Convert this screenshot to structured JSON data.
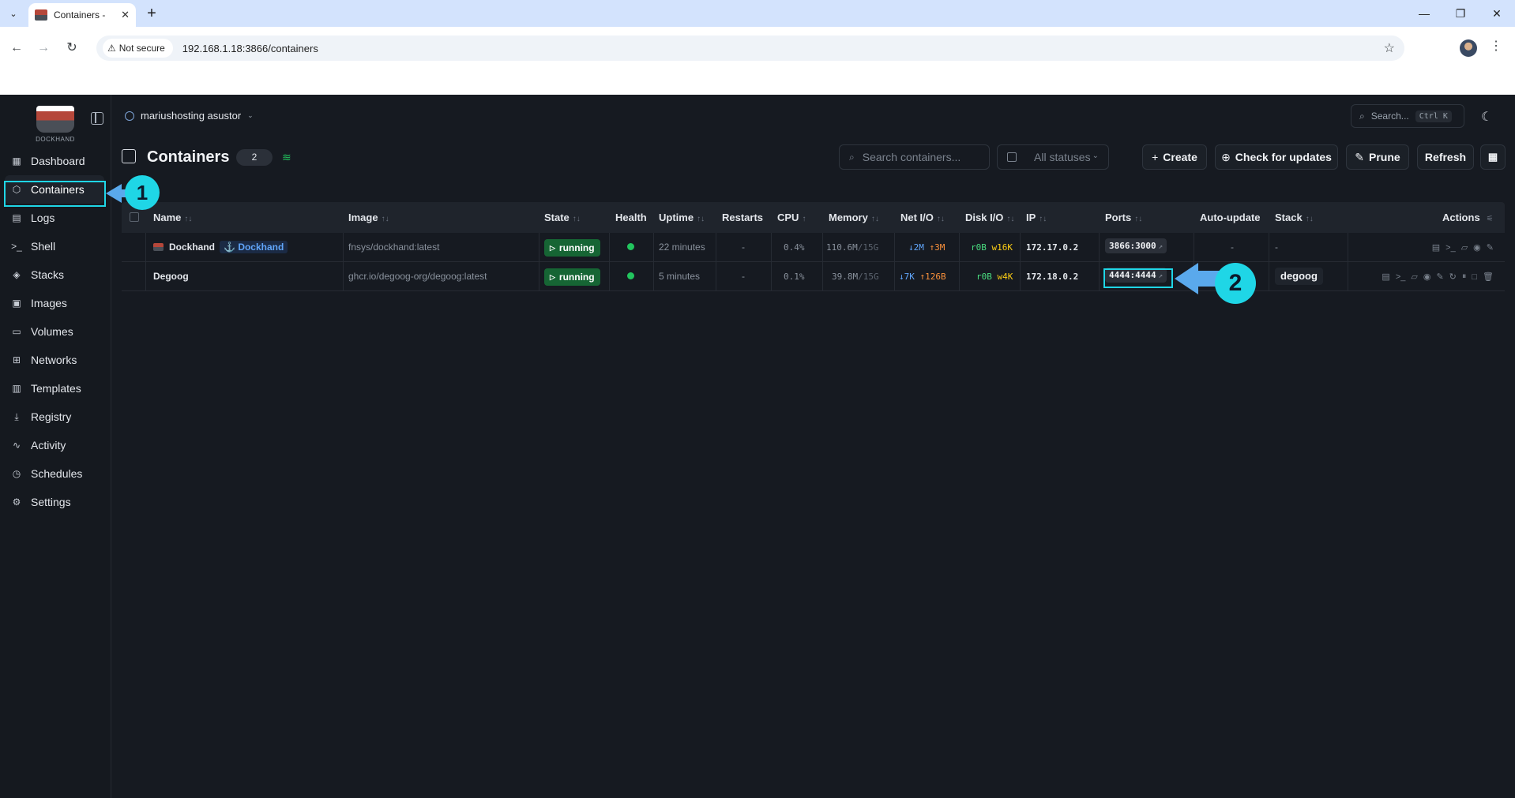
{
  "browser": {
    "tab_title": "Containers -",
    "not_secure": "Not secure",
    "url": "192.168.1.18:3866/containers"
  },
  "sidebar": {
    "logo_text": "DOCKHAND",
    "items": [
      {
        "label": "Dashboard",
        "icon": "dashboard-icon"
      },
      {
        "label": "Containers",
        "icon": "cube-icon"
      },
      {
        "label": "Logs",
        "icon": "logs-icon"
      },
      {
        "label": "Shell",
        "icon": "terminal-icon"
      },
      {
        "label": "Stacks",
        "icon": "layers-icon"
      },
      {
        "label": "Images",
        "icon": "image-icon"
      },
      {
        "label": "Volumes",
        "icon": "drive-icon"
      },
      {
        "label": "Networks",
        "icon": "network-icon"
      },
      {
        "label": "Templates",
        "icon": "library-icon"
      },
      {
        "label": "Registry",
        "icon": "download-icon"
      },
      {
        "label": "Activity",
        "icon": "activity-icon"
      },
      {
        "label": "Schedules",
        "icon": "timer-icon"
      },
      {
        "label": "Settings",
        "icon": "gear-icon"
      }
    ]
  },
  "topbar": {
    "environment": "mariushosting asustor",
    "search_placeholder": "Search...",
    "search_shortcut": "Ctrl K"
  },
  "page": {
    "title": "Containers",
    "count": "2",
    "search_placeholder": "Search containers...",
    "status_filter": "All statuses",
    "create_label": "Create",
    "check_updates_label": "Check for updates",
    "prune_label": "Prune",
    "refresh_label": "Refresh"
  },
  "table": {
    "columns": [
      "Name",
      "Image",
      "State",
      "Health",
      "Uptime",
      "Restarts",
      "CPU",
      "Memory",
      "Net I/O",
      "Disk I/O",
      "IP",
      "Ports",
      "Auto-update",
      "Stack",
      "Actions"
    ],
    "rows": [
      {
        "name": "Dockhand",
        "tag": "Dockhand",
        "image": "fnsys/dockhand:latest",
        "state": "running",
        "uptime": "22 minutes",
        "restarts": "-",
        "cpu": "0.4%",
        "mem_used": "110.6M",
        "mem_total": "/15G",
        "net_down": "↓2M",
        "net_up": "↑3M",
        "disk_r": "r0B",
        "disk_w": "w16K",
        "ip": "172.17.0.2",
        "ports": "3866:3000",
        "auto_update": "-",
        "stack": "-"
      },
      {
        "name": "Degoog",
        "tag": "",
        "image": "ghcr.io/degoog-org/degoog:latest",
        "state": "running",
        "uptime": "5 minutes",
        "restarts": "-",
        "cpu": "0.1%",
        "mem_used": "39.8M",
        "mem_total": "/15G",
        "net_down": "↓7K",
        "net_up": "↑126B",
        "disk_r": "r0B",
        "disk_w": "w4K",
        "ip": "172.18.0.2",
        "ports": "4444:4444",
        "auto_update": "-",
        "stack": "degoog"
      }
    ]
  },
  "annotations": {
    "callout_1": "1",
    "callout_2": "2"
  },
  "colors": {
    "accent_highlight": "#1fd6e6",
    "running_green": "#166534",
    "health_green": "#22c55e"
  }
}
